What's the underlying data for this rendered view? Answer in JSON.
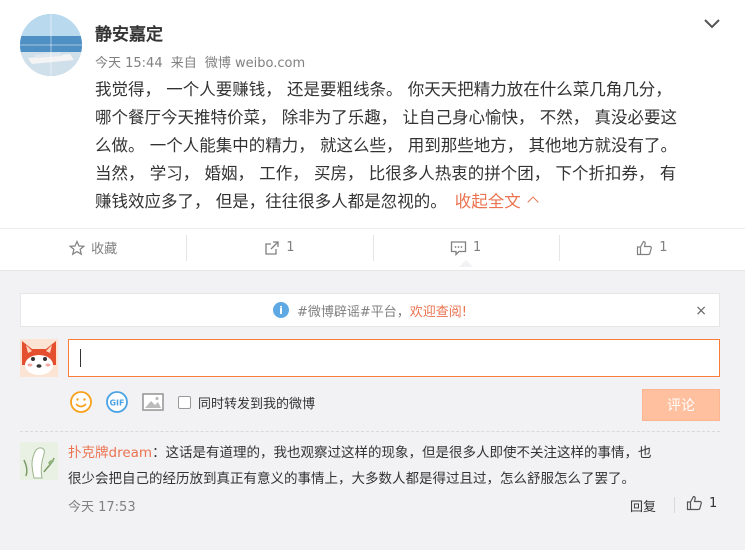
{
  "post": {
    "author": "静安嘉定",
    "time": "今天 15:44",
    "source_prefix": "来自",
    "source": "微博 weibo.com",
    "lines": [
      "我觉得， 一个人要赚钱， 还是要粗线条。 你天天把精力放在什么菜几角几分，",
      "哪个餐厅今天推特价菜， 除非为了乐趣， 让自己身心愉快， 不然， 真没必要这",
      "么做。 一个人能集中的精力， 就这么些， 用到那些地方， 其他地方就没有了。",
      "当然， 学习， 婚姻， 工作， 买房， 比很多人热衷的拼个团， 下个折扣券， 有",
      "赚钱效应多了， 但是，往往很多人都是忽视的。"
    ],
    "collapse_label": "收起全文"
  },
  "actions": {
    "favorite_label": "收藏",
    "repost_count": "1",
    "comment_count": "1",
    "like_count": "1"
  },
  "notice": {
    "tag": "#微博辟谣#平台，",
    "welcome": "欢迎查阅!",
    "close": "×"
  },
  "composer": {
    "forward_label": "同时转发到我的微博",
    "submit_label": "评论"
  },
  "comment": {
    "user": "扑克牌dream",
    "line1_text": "：这话是有道理的，我也观察过这样的现象，但是很多人即使不关注这样的事情，也",
    "line2_text": "很少会把自己的经历放到真正有意义的事情上，大多数人都是得过且过，怎么舒服怎么了罢了。",
    "time": "今天 17:53",
    "reply_label": "回复",
    "like_count": "1"
  },
  "colors": {
    "accent": "#eb7350",
    "input_border": "#fa7d3c",
    "submit_disabled": "#ffc09f",
    "comment_bg": "#f2f2f5"
  },
  "icons": [
    "chevron-down-icon",
    "star-icon",
    "repost-icon",
    "comment-icon",
    "thumbs-up-icon",
    "info-icon",
    "close-icon",
    "smiley-icon",
    "gif-icon",
    "image-icon"
  ]
}
